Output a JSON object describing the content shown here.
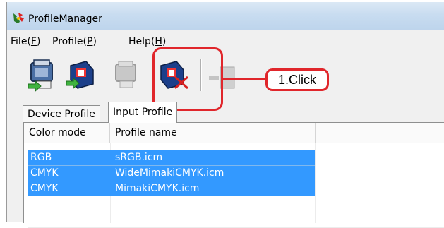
{
  "window": {
    "title": "ProfileManager"
  },
  "menu": [
    {
      "label": "File(",
      "key": "F",
      "suffix": ")"
    },
    {
      "label": "Profile(",
      "key": "P",
      "suffix": ")"
    },
    {
      "label": "Help(",
      "key": "H",
      "suffix": ")"
    }
  ],
  "toolbar": {
    "buttons": [
      {
        "icon": "printer-profile-icon",
        "state": "enabled"
      },
      {
        "icon": "input-profile-add-icon",
        "state": "enabled"
      },
      {
        "icon": "printer-profile-disabled-icon",
        "state": "disabled"
      },
      {
        "icon": "delete-profile-icon",
        "state": "enabled"
      },
      {
        "icon": "export-profile-disabled-icon",
        "state": "disabled"
      }
    ]
  },
  "tabs": {
    "device": "Device Profile",
    "input": "Input Profile",
    "active": "input"
  },
  "list": {
    "headers": [
      "Color mode",
      "Profile name"
    ],
    "rows": [
      {
        "mode": "RGB",
        "name": "sRGB.icm",
        "selected": true
      },
      {
        "mode": "CMYK",
        "name": "WideMimakiCMYK.icm",
        "selected": true
      },
      {
        "mode": "CMYK",
        "name": "MimakiCMYK.icm",
        "selected": true
      }
    ]
  },
  "annotation": {
    "label": "1.Click",
    "color": "#e0262b"
  },
  "colors": {
    "selection": "#3399ff",
    "titlebar": "#c8dcf0"
  }
}
